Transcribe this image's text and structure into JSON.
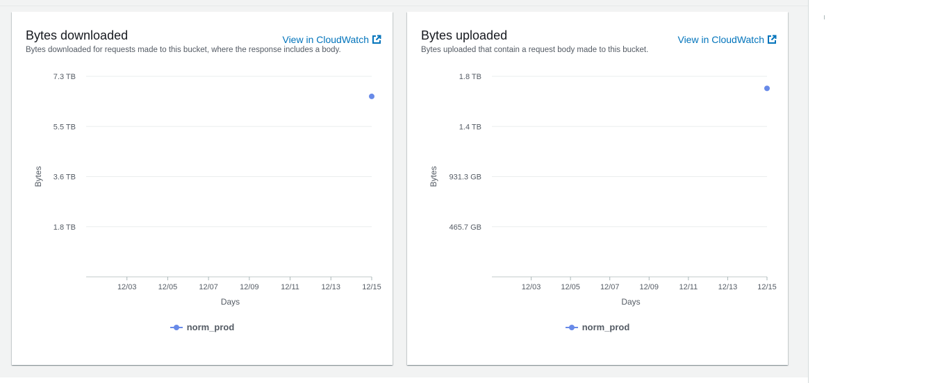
{
  "cards": [
    {
      "title": "Bytes downloaded",
      "description": "Bytes downloaded for requests made to this bucket, where the response includes a body.",
      "link_label": "View in CloudWatch",
      "link_icon": "external-link-icon"
    },
    {
      "title": "Bytes uploaded",
      "description": "Bytes uploaded that contain a request body made to this bucket.",
      "link_label": "View in CloudWatch",
      "link_icon": "external-link-icon"
    }
  ],
  "colors": {
    "accent": "#0073bb",
    "series": "#688ae8",
    "grid": "#eaeded"
  },
  "chart_data": [
    {
      "type": "scatter",
      "title": "Bytes downloaded",
      "xlabel": "Days",
      "ylabel": "Bytes",
      "x_ticks": [
        "12/03",
        "12/05",
        "12/07",
        "12/09",
        "12/11",
        "12/13",
        "12/15"
      ],
      "y_ticks": [
        "7.3 TB",
        "5.5 TB",
        "3.6 TB",
        "1.8 TB"
      ],
      "y_tick_values": [
        8.0,
        6.0,
        4.0,
        2.0
      ],
      "ylim": [
        0,
        8.0
      ],
      "y_unit": "TiB",
      "x_range": [
        "12/01",
        "12/15"
      ],
      "series": [
        {
          "name": "norm_prod",
          "points": [
            {
              "x": "12/15",
              "y": 7.2
            }
          ]
        }
      ],
      "legend_position": "bottom",
      "grid": true
    },
    {
      "type": "scatter",
      "title": "Bytes uploaded",
      "xlabel": "Days",
      "ylabel": "Bytes",
      "x_ticks": [
        "12/03",
        "12/05",
        "12/07",
        "12/09",
        "12/11",
        "12/13",
        "12/15"
      ],
      "y_ticks": [
        "1.8 TB",
        "1.4 TB",
        "931.3 GB",
        "465.7 GB"
      ],
      "y_tick_values": [
        2.0,
        1.5,
        1.0,
        0.5
      ],
      "ylim": [
        0,
        2.0
      ],
      "y_unit": "TiB",
      "x_range": [
        "12/01",
        "12/15"
      ],
      "series": [
        {
          "name": "norm_prod",
          "points": [
            {
              "x": "12/15",
              "y": 1.88
            }
          ]
        }
      ],
      "legend_position": "bottom",
      "grid": true
    }
  ]
}
